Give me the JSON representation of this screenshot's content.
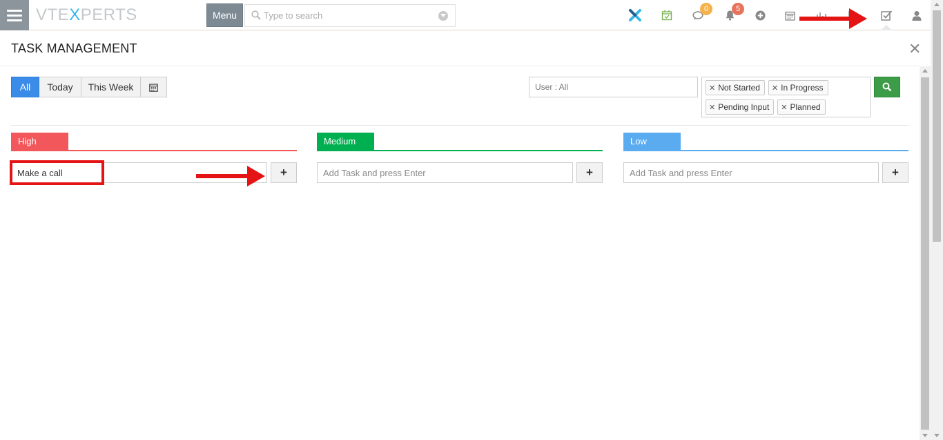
{
  "header": {
    "logo_pre": "VTE",
    "logo_x": "X",
    "logo_post": "PERTS",
    "menu_label": "Menu",
    "search_placeholder": "Type to search",
    "comments_badge": "0",
    "notifications_badge": "5"
  },
  "panel": {
    "title": "TASK MANAGEMENT",
    "filters": {
      "buttons": [
        "All",
        "Today",
        "This Week"
      ],
      "active": "All",
      "user_filter": "User : All",
      "statuses": [
        "Not Started",
        "In Progress",
        "Pending Input",
        "Planned"
      ]
    },
    "columns": [
      {
        "label": "High",
        "color": "#f2585b",
        "input_value": "Make a call",
        "placeholder": "Add Task and press Enter",
        "add_label": "+"
      },
      {
        "label": "Medium",
        "color": "#00b050",
        "input_value": "",
        "placeholder": "Add Task and press Enter",
        "add_label": "+"
      },
      {
        "label": "Low",
        "color": "#5aabf0",
        "input_value": "",
        "placeholder": "Add Task and press Enter",
        "add_label": "+"
      }
    ]
  },
  "colors": {
    "active_filter": "#3b8be8",
    "search_button": "#3c9c48",
    "annotation": "#e41414"
  }
}
